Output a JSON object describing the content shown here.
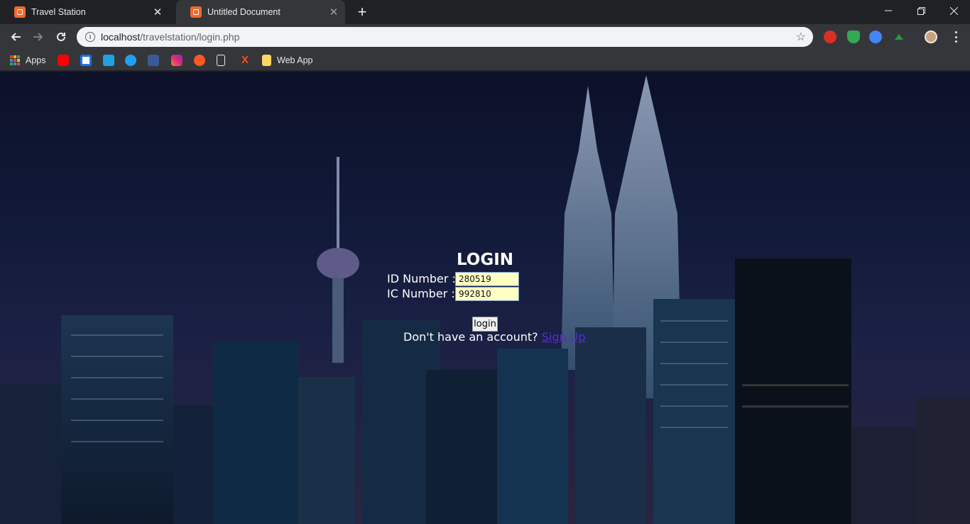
{
  "browser": {
    "tabs": [
      {
        "title": "Travel Station",
        "active": false
      },
      {
        "title": "Untitled Document",
        "active": true
      }
    ],
    "address": {
      "host": "localhost",
      "path": "/travelstation/login.php"
    },
    "bookmarks": {
      "apps_label": "Apps",
      "web_app_label": "Web App"
    }
  },
  "page": {
    "title": "LOGIN",
    "id_label": "ID Number :",
    "id_value": "280519",
    "ic_label": "IC Number :",
    "ic_value": "992810",
    "login_button": "login",
    "signup_prompt": "Don't have an account?",
    "signup_link": "Sign Up"
  },
  "colors": {
    "input_bg": "#ffffc4",
    "link": "#5b2bd3",
    "tab_accent": "#f0692c"
  }
}
